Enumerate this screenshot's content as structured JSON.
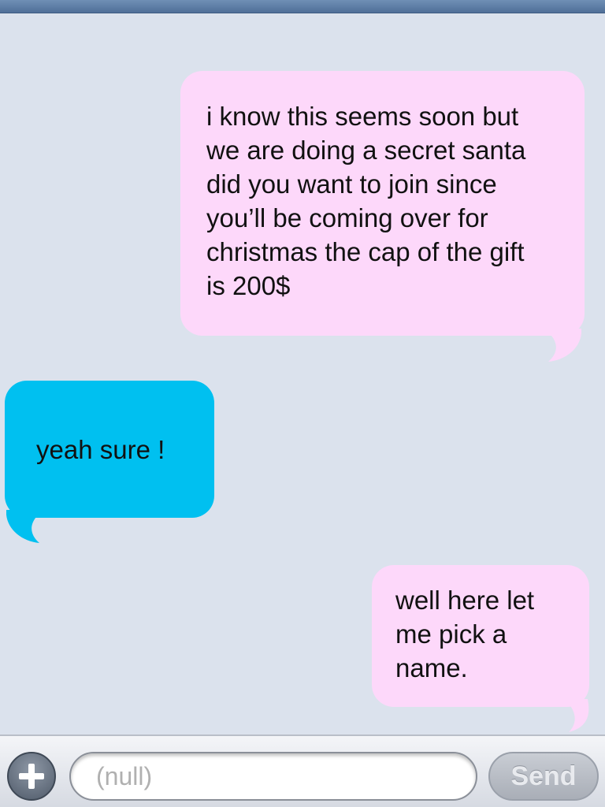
{
  "thread": {
    "messages": [
      {
        "direction": "sent",
        "lines": [
          "i know this seems soon but",
          "we are doing a secret santa",
          "did you want to join since",
          "you’ll be coming over for",
          "christmas the cap of the gift",
          "is 200$"
        ]
      },
      {
        "direction": "received",
        "lines": [
          "yeah sure !"
        ]
      },
      {
        "direction": "sent",
        "lines": [
          "well here let",
          "me pick a",
          "name."
        ]
      }
    ]
  },
  "composer": {
    "add_icon": "plus-icon",
    "placeholder": "(null)",
    "value": "",
    "send_label": "Send"
  },
  "colors": {
    "background": "#dbe2ed",
    "sent_bubble": "#fdd8fa",
    "received_bubble": "#00c0f0"
  }
}
